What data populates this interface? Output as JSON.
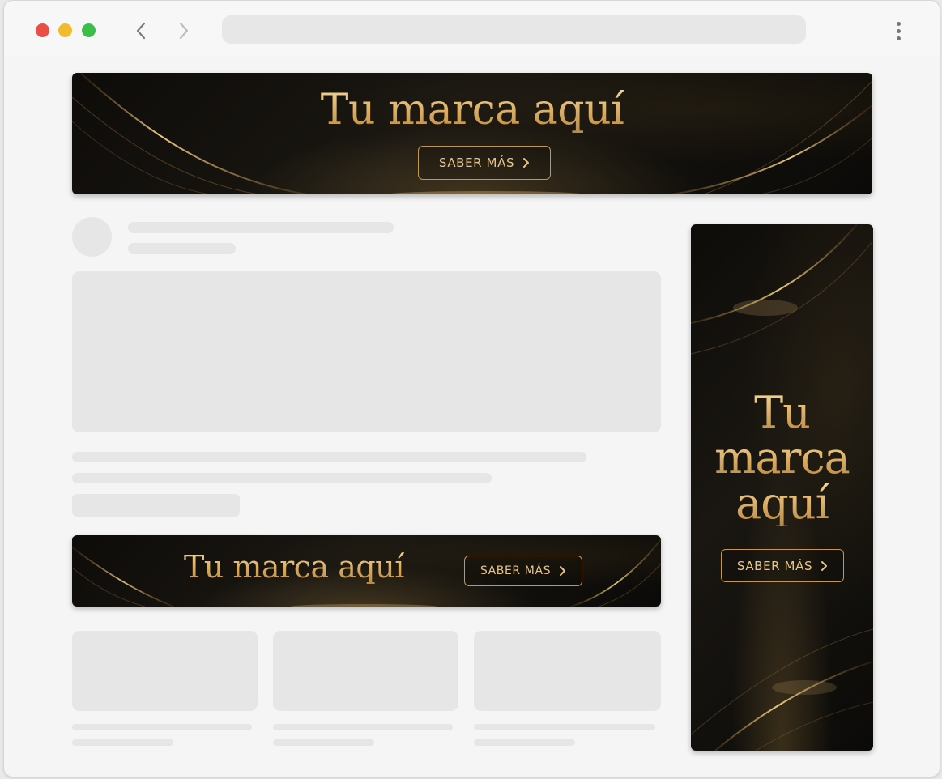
{
  "browser": {
    "window_controls": [
      "close",
      "minimize",
      "maximize"
    ],
    "nav": {
      "back_icon": "chevron-left-icon",
      "forward_icon": "chevron-right-icon"
    },
    "address_bar_value": "",
    "menu_icon": "vertical-dots-icon"
  },
  "ads": {
    "top_banner": {
      "headline": "Tu marca aquí",
      "cta": "SABER MÁS"
    },
    "inline_banner": {
      "headline": "Tu marca aquí",
      "cta": "SABER MÁS"
    },
    "side_banner": {
      "headline_lines": [
        "Tu",
        "marca",
        "aquí"
      ],
      "cta": "SABER MÁS"
    }
  },
  "colors": {
    "gold": "#e2bb7b",
    "banner_dark": "#0e0c09",
    "placeholder_gray": "#e6e6e6",
    "traffic_red": "#ea4f46",
    "traffic_yellow": "#f2bb2d",
    "traffic_green": "#3cbf4a"
  }
}
